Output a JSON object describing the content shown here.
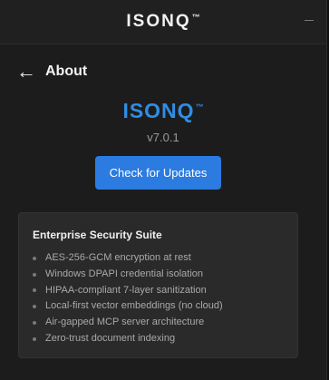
{
  "window": {
    "title": "ISONQ",
    "trademark": "™"
  },
  "header": {
    "back_icon": "←",
    "title": "About"
  },
  "brand": {
    "name": "ISONQ",
    "trademark": "™",
    "version": "v7.0.1",
    "color": "#2f8de4"
  },
  "actions": {
    "check_updates_label": "Check for Updates",
    "accent": "#2b7be0"
  },
  "features": {
    "title": "Enterprise Security Suite",
    "items": [
      "AES-256-GCM encryption at rest",
      "Windows DPAPI credential isolation",
      "HIPAA-compliant 7-layer sanitization",
      "Local-first vector embeddings (no cloud)",
      "Air-gapped MCP server architecture",
      "Zero-trust document indexing"
    ]
  }
}
